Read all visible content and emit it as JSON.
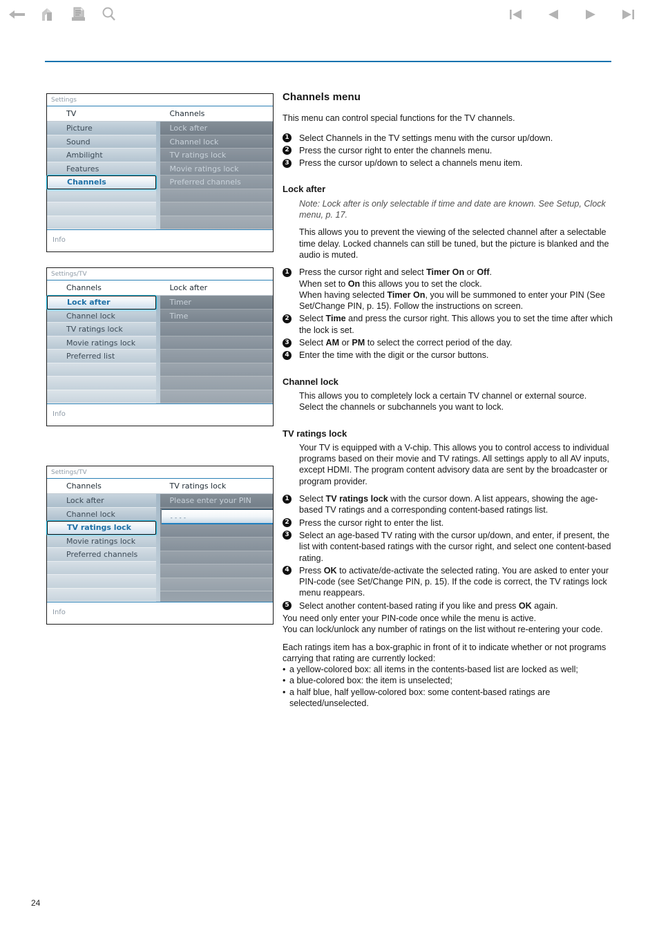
{
  "toolbar": {
    "back_label": "Back",
    "home_label": "Home",
    "print_label": "Print",
    "search_label": "Search",
    "first_label": "First page",
    "prev_label": "Previous page",
    "next_label": "Next page",
    "last_label": "Last page"
  },
  "page_number": "24",
  "screenshots": [
    {
      "breadcrumb": "Settings",
      "left_title": "TV",
      "right_title": "Channels",
      "left_items": [
        "Picture",
        "Sound",
        "Ambilight",
        "Features",
        "Channels",
        "",
        "",
        "",
        ""
      ],
      "left_selected_index": 4,
      "right_items": [
        "Lock after",
        "Channel lock",
        "TV ratings lock",
        "Movie ratings lock",
        "Preferred channels",
        "",
        "",
        "",
        ""
      ],
      "info": "Info"
    },
    {
      "breadcrumb": "Settings/TV",
      "left_title": "Channels",
      "right_title": "Lock after",
      "left_items": [
        "Lock after",
        "Channel lock",
        "TV ratings lock",
        "Movie ratings lock",
        "Preferred list",
        "",
        "",
        "",
        ""
      ],
      "left_selected_index": 0,
      "right_items": [
        "Timer",
        "Time",
        "",
        "",
        "",
        "",
        "",
        "",
        ""
      ],
      "info": "Info"
    },
    {
      "breadcrumb": "Settings/TV",
      "left_title": "Channels",
      "right_title": "TV ratings lock",
      "left_items": [
        "Lock after",
        "Channel lock",
        "TV ratings lock",
        "Movie ratings lock",
        "Preferred channels",
        "",
        "",
        "",
        ""
      ],
      "left_selected_index": 2,
      "right_prompt": "Please enter your PIN",
      "pin_value": "----",
      "right_items": [
        "",
        "",
        "",
        "",
        "",
        "",
        ""
      ],
      "info": "Info"
    }
  ],
  "article": {
    "title": "Channels menu",
    "lead": "This menu can control special functions for the TV channels.",
    "intro_steps": [
      "Select Channels in the TV settings menu with the cursor up/down.",
      "Press the cursor right to enter the channels menu.",
      "Press the cursor up/down to select a channels menu item."
    ],
    "lock_after": {
      "heading": "Lock after",
      "note": "Note: Lock after is only selectable if time and date are known. See Setup, Clock menu, p. 17.",
      "body": "This allows you to prevent the viewing of the selected channel after a selectable time delay. Locked channels can still be tuned, but the picture is blanked and the audio is muted.",
      "steps": [
        "Press the cursor right and select Timer On or Off.",
        "Select Time and press the cursor right. This allows you to set the time after which the lock is set.",
        "Select AM or PM to select the correct period of the day.",
        "Enter the time with the digit or the cursor buttons."
      ],
      "step1_line2": "When set to On this allows you to set the clock.",
      "step1_line3": "When having selected Timer On, you will be summoned to enter your PIN (See Set/Change PIN, p. 15). Follow the instructions on screen."
    },
    "channel_lock": {
      "heading": "Channel lock",
      "body": "This allows you to completely lock a certain TV channel or external source. Select the channels or subchannels you want to lock."
    },
    "tv_ratings_lock": {
      "heading": "TV ratings lock",
      "body": "Your TV is equipped with a V-chip. This allows you to control access to individual programs based on their movie and TV ratings. All settings apply to all AV inputs, except HDMI. The program content advisory data are sent by the broadcaster or program provider.",
      "steps": [
        "Select TV ratings lock with the cursor down. A list appears, showing the age-based TV ratings and a corresponding content-based ratings list.",
        "Press the cursor right to enter the list.",
        "Select an age-based TV rating with the cursor up/down, and enter, if present, the list with content-based ratings with the cursor right, and select one content-based rating.",
        "Press OK to activate/de-activate the selected rating. You are asked to enter your PIN-code (see Set/Change PIN, p. 15). If the code is correct, the TV ratings lock menu reappears.",
        "Select another content-based rating if you like and press OK again."
      ],
      "closing1": "You need only enter your PIN-code once while the menu is active.",
      "closing2": "You can lock/unlock any number of ratings on the list without re-entering your code.",
      "box_intro": "Each ratings item has a box-graphic in front of it to indicate whether or not programs carrying that rating are currently locked:",
      "box_bullets": [
        "a yellow-colored box: all items in the contents-based list are locked as well;",
        "a blue-colored box: the item is unselected;",
        "a half blue, half yellow-colored box: some content-based ratings are selected/unselected."
      ]
    }
  },
  "colors": {
    "rule": "#0b72ae",
    "icon_gray": "#b3b3b3",
    "menu_highlight": "#30c8ef",
    "menu_selected_text": "#1d6fa5"
  }
}
